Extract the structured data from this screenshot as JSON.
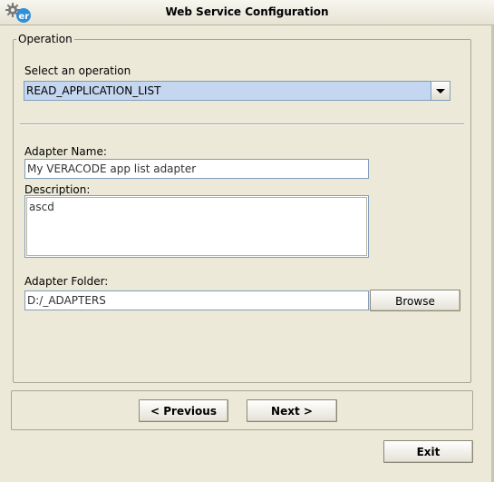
{
  "window": {
    "title": "Web Service Configuration",
    "icon": "gear-er-icon"
  },
  "operation_group": {
    "legend": "Operation",
    "select_label": "Select an operation",
    "selected_operation": "READ_APPLICATION_LIST"
  },
  "adapter": {
    "name_label": "Adapter Name:",
    "name_value": "My VERACODE app list adapter",
    "description_label": "Description:",
    "description_value": "ascd",
    "folder_label": "Adapter Folder:",
    "folder_value": "D:/_ADAPTERS",
    "browse_label": "Browse"
  },
  "navigation": {
    "previous_label": "< Previous",
    "next_label": "Next >"
  },
  "footer": {
    "exit_label": "Exit"
  }
}
